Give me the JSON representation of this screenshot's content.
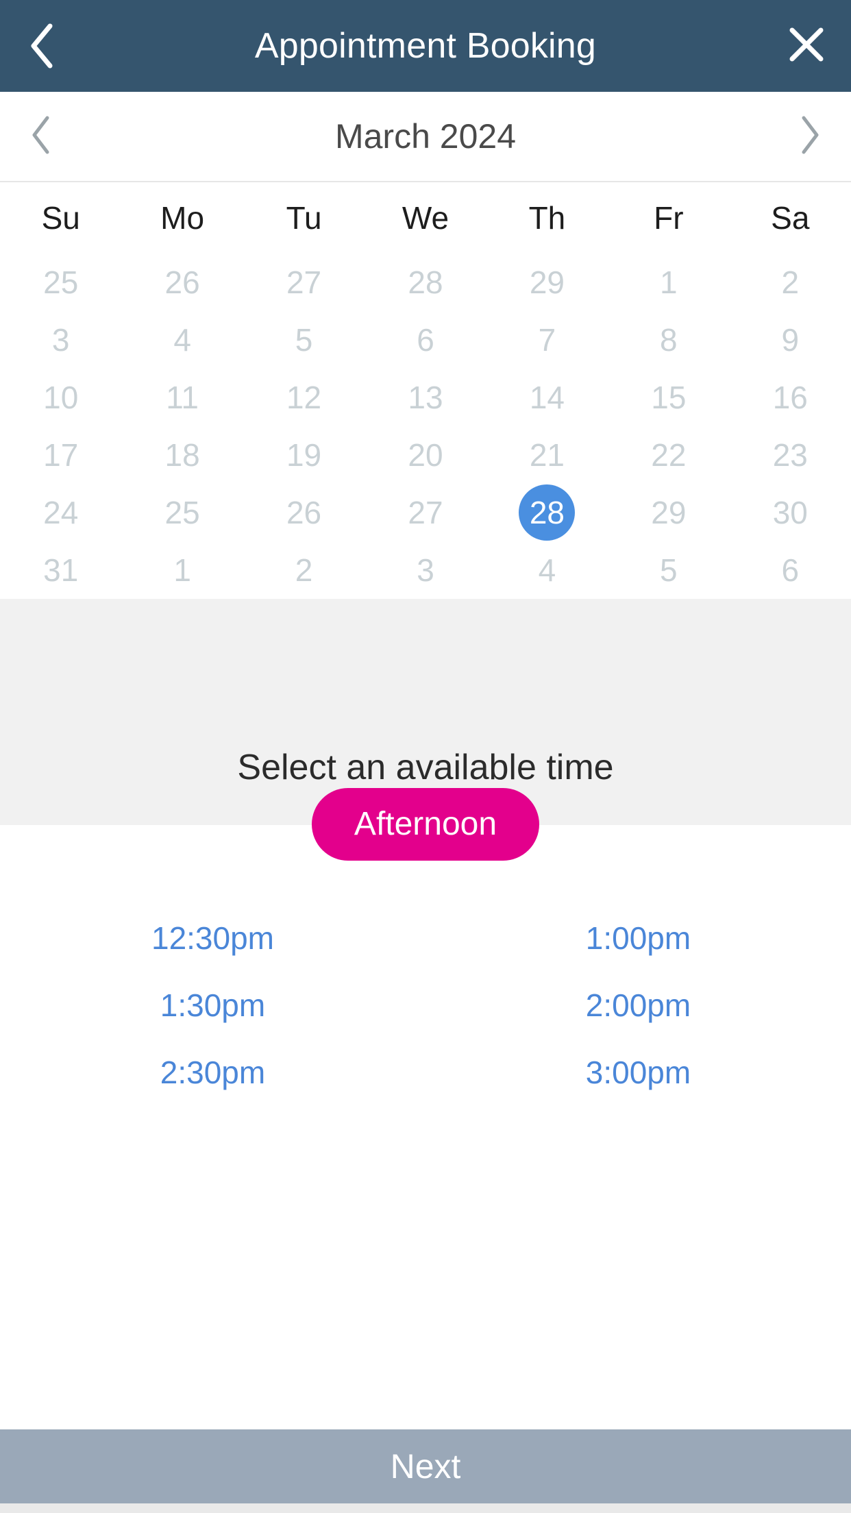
{
  "header": {
    "title": "Appointment Booking",
    "back_icon": "chevron-left-icon",
    "close_icon": "close-icon",
    "background": "#35556e"
  },
  "calendar": {
    "month_label": "March 2024",
    "prev_icon": "chevron-left-icon",
    "next_icon": "chevron-right-icon",
    "weekdays": [
      "Su",
      "Mo",
      "Tu",
      "We",
      "Th",
      "Fr",
      "Sa"
    ],
    "selected_day": "28",
    "selected_color": "#4a8fe0",
    "muted_color": "#c9d1d5",
    "weeks": [
      [
        {
          "label": "25",
          "state": "muted"
        },
        {
          "label": "26",
          "state": "muted"
        },
        {
          "label": "27",
          "state": "muted"
        },
        {
          "label": "28",
          "state": "muted"
        },
        {
          "label": "29",
          "state": "muted"
        },
        {
          "label": "1",
          "state": "muted"
        },
        {
          "label": "2",
          "state": "muted"
        }
      ],
      [
        {
          "label": "3",
          "state": "muted"
        },
        {
          "label": "4",
          "state": "muted"
        },
        {
          "label": "5",
          "state": "muted"
        },
        {
          "label": "6",
          "state": "muted"
        },
        {
          "label": "7",
          "state": "muted"
        },
        {
          "label": "8",
          "state": "muted"
        },
        {
          "label": "9",
          "state": "muted"
        }
      ],
      [
        {
          "label": "10",
          "state": "muted"
        },
        {
          "label": "11",
          "state": "muted"
        },
        {
          "label": "12",
          "state": "muted"
        },
        {
          "label": "13",
          "state": "muted"
        },
        {
          "label": "14",
          "state": "muted"
        },
        {
          "label": "15",
          "state": "muted"
        },
        {
          "label": "16",
          "state": "muted"
        }
      ],
      [
        {
          "label": "17",
          "state": "muted"
        },
        {
          "label": "18",
          "state": "muted"
        },
        {
          "label": "19",
          "state": "muted"
        },
        {
          "label": "20",
          "state": "muted"
        },
        {
          "label": "21",
          "state": "muted"
        },
        {
          "label": "22",
          "state": "muted"
        },
        {
          "label": "23",
          "state": "muted"
        }
      ],
      [
        {
          "label": "24",
          "state": "muted"
        },
        {
          "label": "25",
          "state": "muted"
        },
        {
          "label": "26",
          "state": "muted"
        },
        {
          "label": "27",
          "state": "muted"
        },
        {
          "label": "28",
          "state": "selected"
        },
        {
          "label": "29",
          "state": "muted"
        },
        {
          "label": "30",
          "state": "muted"
        }
      ],
      [
        {
          "label": "31",
          "state": "muted"
        },
        {
          "label": "1",
          "state": "muted"
        },
        {
          "label": "2",
          "state": "muted"
        },
        {
          "label": "3",
          "state": "muted"
        },
        {
          "label": "4",
          "state": "muted"
        },
        {
          "label": "5",
          "state": "muted"
        },
        {
          "label": "6",
          "state": "muted"
        }
      ]
    ]
  },
  "time_section": {
    "heading": "Select an available time",
    "period_label": "Afternoon",
    "period_color": "#e3008c",
    "slot_color": "#4a86d8",
    "slots": [
      "12:30pm",
      "1:00pm",
      "1:30pm",
      "2:00pm",
      "2:30pm",
      "3:00pm"
    ]
  },
  "footer": {
    "next_label": "Next",
    "next_color": "#9aa8b8"
  }
}
